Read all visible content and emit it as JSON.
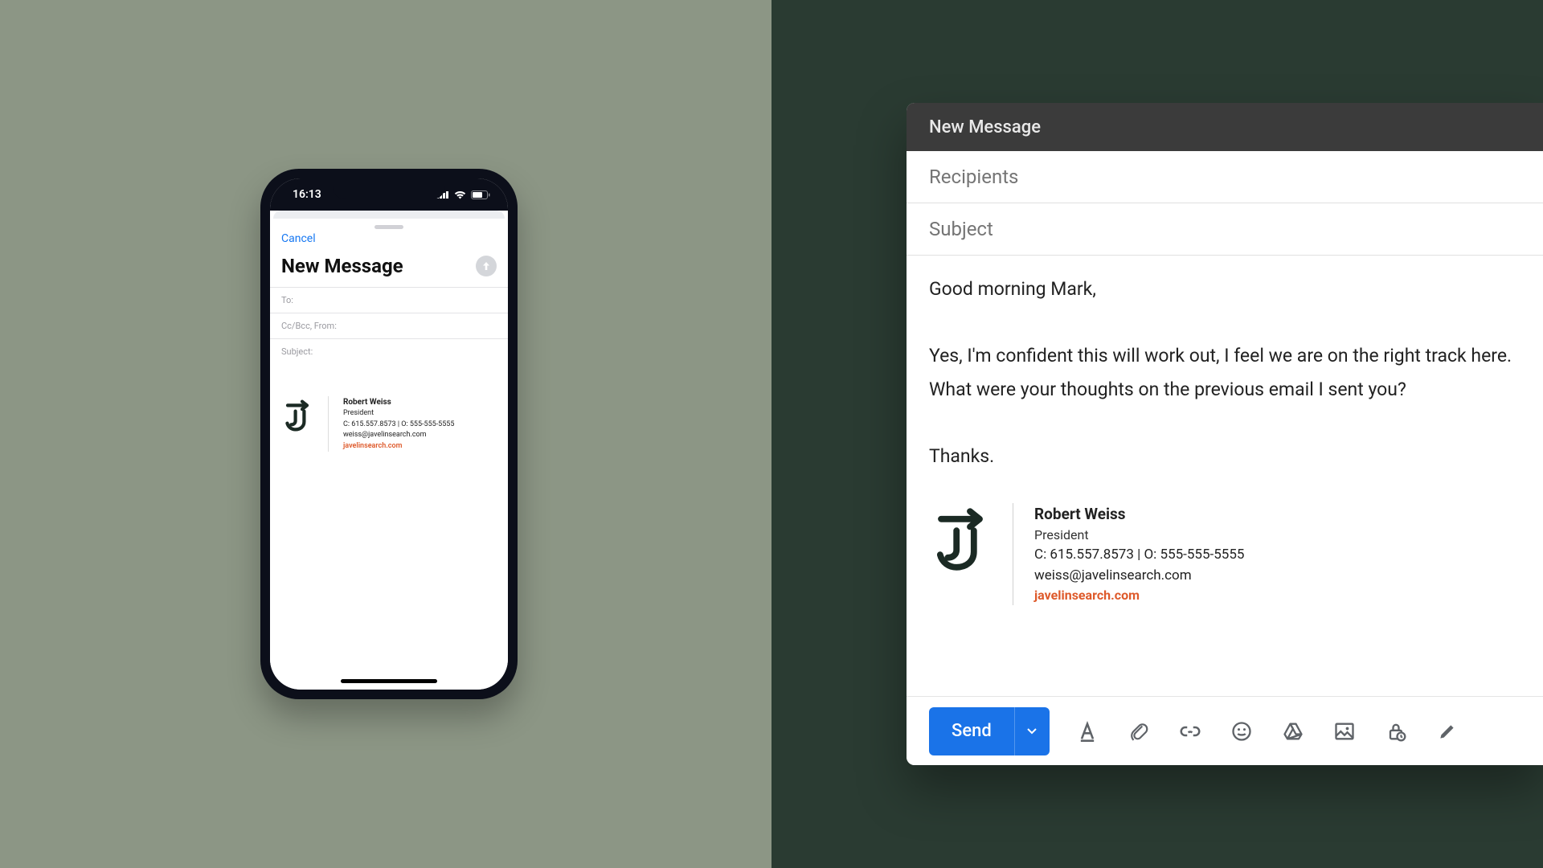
{
  "phone": {
    "status": {
      "time": "16:13"
    },
    "cancel": "Cancel",
    "title": "New Message",
    "fields": {
      "to": "To:",
      "ccbcc": "Cc/Bcc, From:",
      "subject": "Subject:"
    },
    "signature": {
      "name": "Robert Weiss",
      "title": "President",
      "phones": "C: 615.557.8573 | O: 555-555-5555",
      "email": "weiss@javelinsearch.com",
      "link": "javelinsearch.com"
    }
  },
  "gmail": {
    "header": "New Message",
    "recipients_placeholder": "Recipients",
    "subject_placeholder": "Subject",
    "body": {
      "l1": "Good morning Mark,",
      "l2": "Yes, I'm confident this will work out, I feel we are on the right track here.",
      "l3": "What were your thoughts on the previous email I sent you?",
      "l4": "Thanks."
    },
    "signature": {
      "name": "Robert Weiss",
      "title": "President",
      "phones": "C: 615.557.8573 | O: 555-555-5555",
      "email": "weiss@javelinsearch.com",
      "link": "javelinsearch.com"
    },
    "send": "Send"
  }
}
